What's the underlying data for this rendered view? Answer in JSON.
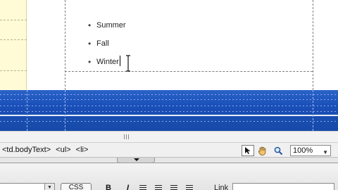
{
  "design_view": {
    "list_items": [
      "Summer",
      "Fall",
      "Winter"
    ],
    "bullet_glyph": "•"
  },
  "status_bar": {
    "tag_path": [
      "<td.bodyText>",
      "<ul>",
      "<li>"
    ],
    "zoom_value": "100%",
    "tools": [
      "select-tool",
      "hand-tool",
      "zoom-tool"
    ]
  },
  "properties": {
    "css_label": "CSS",
    "bold_label": "B",
    "italic_label": "I",
    "link_label": "Link"
  },
  "colors": {
    "design_band": "#1a4fb8",
    "left_column": "#fffbd6",
    "panel_bg": "#f0f0f0"
  }
}
